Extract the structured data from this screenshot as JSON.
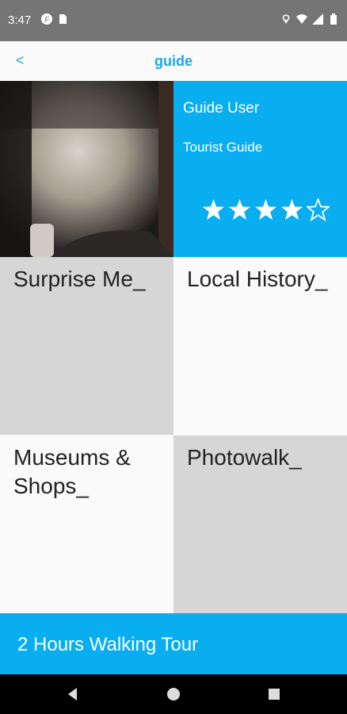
{
  "status_bar": {
    "time": "3:47",
    "icons": [
      "f-icon",
      "sd-card-icon",
      "location-icon",
      "wifi-icon",
      "signal-icon",
      "battery-icon"
    ]
  },
  "header": {
    "back_label": "<",
    "title": "guide"
  },
  "guide": {
    "name": "Guide User",
    "role": "Tourist Guide",
    "rating": 4,
    "rating_max": 5
  },
  "tiles": [
    {
      "label": "Surprise Me_",
      "bg": "#d6d6d6"
    },
    {
      "label": "Local History_",
      "bg": "#fafafa"
    },
    {
      "label": "Museums & Shops_",
      "bg": "#fafafa"
    },
    {
      "label": "Photowalk_",
      "bg": "#d6d6d6"
    }
  ],
  "bottom_button": {
    "label": "2 Hours Walking Tour"
  },
  "colors": {
    "accent": "#09aef0",
    "title_blue": "#1ea5e8"
  },
  "nav": {
    "icons": [
      "back-nav-icon",
      "home-nav-icon",
      "recents-nav-icon"
    ]
  }
}
